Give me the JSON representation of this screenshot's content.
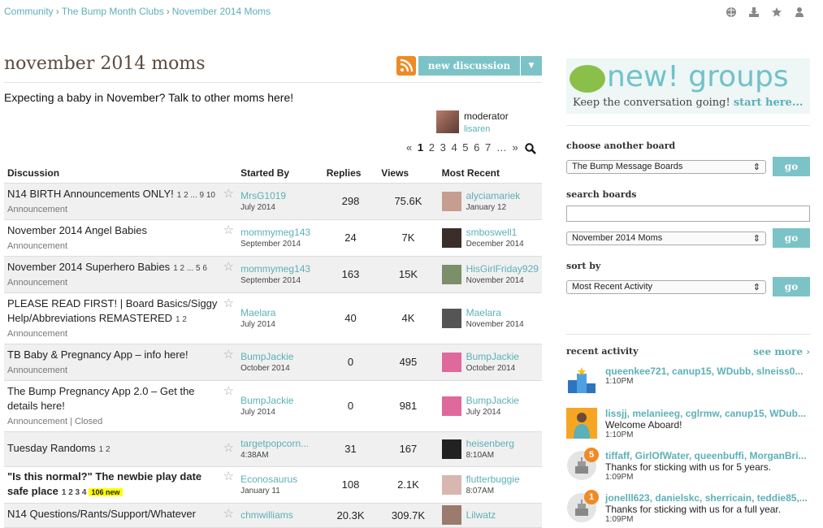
{
  "breadcrumb": [
    {
      "label": "Community"
    },
    {
      "label": "The Bump Month Clubs"
    },
    {
      "label": "November 2014 Moms"
    }
  ],
  "breadcrumb_sep": "›",
  "top_icons": [
    "globe-icon",
    "download-icon",
    "star-icon",
    "user-icon"
  ],
  "board": {
    "title": "november 2014 moms",
    "description": "Expecting a baby in November? Talk to other moms here!",
    "new_discussion_label": "new discussion",
    "moderator_label": "moderator",
    "moderator_name": "lisaren"
  },
  "pager": {
    "prev": "«",
    "pages": [
      "1",
      "2",
      "3",
      "4",
      "5",
      "6",
      "7"
    ],
    "ellipsis": "…",
    "next": "»",
    "current": "1"
  },
  "table": {
    "headers": [
      "Discussion",
      "Started By",
      "Replies",
      "Views",
      "Most Recent"
    ],
    "rows": [
      {
        "title": "N14 BIRTH Announcements ONLY!",
        "pages": "1 2 ... 9 10",
        "sub": "Announcement",
        "starter": "MrsG1019",
        "started": "July 2014",
        "replies": "298",
        "views": "75.6K",
        "recent_user": "alyciamariek",
        "recent_time": "January 12",
        "avatar_color": "#c79d8f",
        "bold": false,
        "badge": ""
      },
      {
        "title": "November 2014 Angel Babies",
        "pages": "",
        "sub": "Announcement",
        "starter": "mommymeg143",
        "started": "September 2014",
        "replies": "24",
        "views": "7K",
        "recent_user": "smboswell1",
        "recent_time": "December 2014",
        "avatar_color": "#3b2e2a",
        "bold": false,
        "badge": ""
      },
      {
        "title": "November 2014 Superhero Babies",
        "pages": "1 2 ... 5 6",
        "sub": "Announcement",
        "starter": "mommymeg143",
        "started": "September 2014",
        "replies": "163",
        "views": "15K",
        "recent_user": "HisGirlFriday929",
        "recent_time": "November 2014",
        "avatar_color": "#7a8f6a",
        "bold": false,
        "badge": ""
      },
      {
        "title": "PLEASE READ FIRST! | Board Basics/Siggy Help/Abbreviations REMASTERED",
        "pages": "1 2",
        "sub": "Announcement",
        "starter": "Maelara",
        "started": "July 2014",
        "replies": "40",
        "views": "4K",
        "recent_user": "Maelara",
        "recent_time": "November 2014",
        "avatar_color": "#555555",
        "bold": false,
        "badge": ""
      },
      {
        "title": "TB Baby & Pregnancy App – info here!",
        "pages": "",
        "sub": "Announcement",
        "starter": "BumpJackie",
        "started": "October 2014",
        "replies": "0",
        "views": "495",
        "recent_user": "BumpJackie",
        "recent_time": "October 2014",
        "avatar_color": "#e0699b",
        "bold": false,
        "badge": ""
      },
      {
        "title": "The Bump Pregnancy App 2.0 – Get the details here!",
        "pages": "",
        "sub": "Announcement | Closed",
        "starter": "BumpJackie",
        "started": "July 2014",
        "replies": "0",
        "views": "981",
        "recent_user": "BumpJackie",
        "recent_time": "July 2014",
        "avatar_color": "#e0699b",
        "bold": false,
        "badge": ""
      },
      {
        "title": "Tuesday Randoms",
        "pages": "1 2",
        "sub": "",
        "starter": "targetpopcorn...",
        "started": "4:38AM",
        "replies": "31",
        "views": "167",
        "recent_user": "heisenberg",
        "recent_time": "8:10AM",
        "avatar_color": "#222222",
        "bold": false,
        "badge": ""
      },
      {
        "title": "\"Is this normal?\" The newbie play date safe place",
        "pages": "1 2 3 4",
        "sub": "",
        "starter": "Econosaurus",
        "started": "January 11",
        "replies": "108",
        "views": "2.1K",
        "recent_user": "flutterbuggie",
        "recent_time": "8:07AM",
        "avatar_color": "#d8b7b0",
        "bold": true,
        "badge": "106 new"
      },
      {
        "title": "N14 Questions/Rants/Support/Whatever",
        "pages": "",
        "sub": "",
        "starter": "chmwilliams",
        "started": "",
        "replies": "20.3K",
        "views": "309.7K",
        "recent_user": "Lilwatz",
        "recent_time": "",
        "avatar_color": "#9b7b6b",
        "bold": false,
        "badge": ""
      }
    ]
  },
  "sidebar": {
    "banner_big": "new! groups",
    "banner_small": "Keep the conversation going!",
    "banner_link": "start here...",
    "choose_label": "choose another board",
    "choose_value": "The Bump Message Boards",
    "search_label": "search boards",
    "search_value": "November 2014 Moms",
    "sort_label": "sort by",
    "sort_value": "Most Recent Activity",
    "go_label": "go",
    "recent_label": "recent activity",
    "see_more": "see more ›",
    "activity": [
      {
        "names": "queenkee721, canup15, WDubb, slneiss0...",
        "msg": "",
        "time": "1:10PM",
        "icon": "podium-icon",
        "count": ""
      },
      {
        "names": "lissjj, melanieeg, cglrmw, canup15, WDub...",
        "msg": "Welcome Aboard!",
        "time": "1:10PM",
        "icon": "welcome-icon",
        "count": ""
      },
      {
        "names": "tiffaff, GirlOfWater, queenbuffi, MorganBri...",
        "msg": "Thanks for sticking with us for 5 years.",
        "time": "1:09PM",
        "icon": "cake-icon",
        "count": "5"
      },
      {
        "names": "jonelll623, danielskc, sherricain, teddie85,...",
        "msg": "Thanks for sticking with us for a full year.",
        "time": "1:09PM",
        "icon": "cake-icon",
        "count": "1"
      }
    ]
  }
}
